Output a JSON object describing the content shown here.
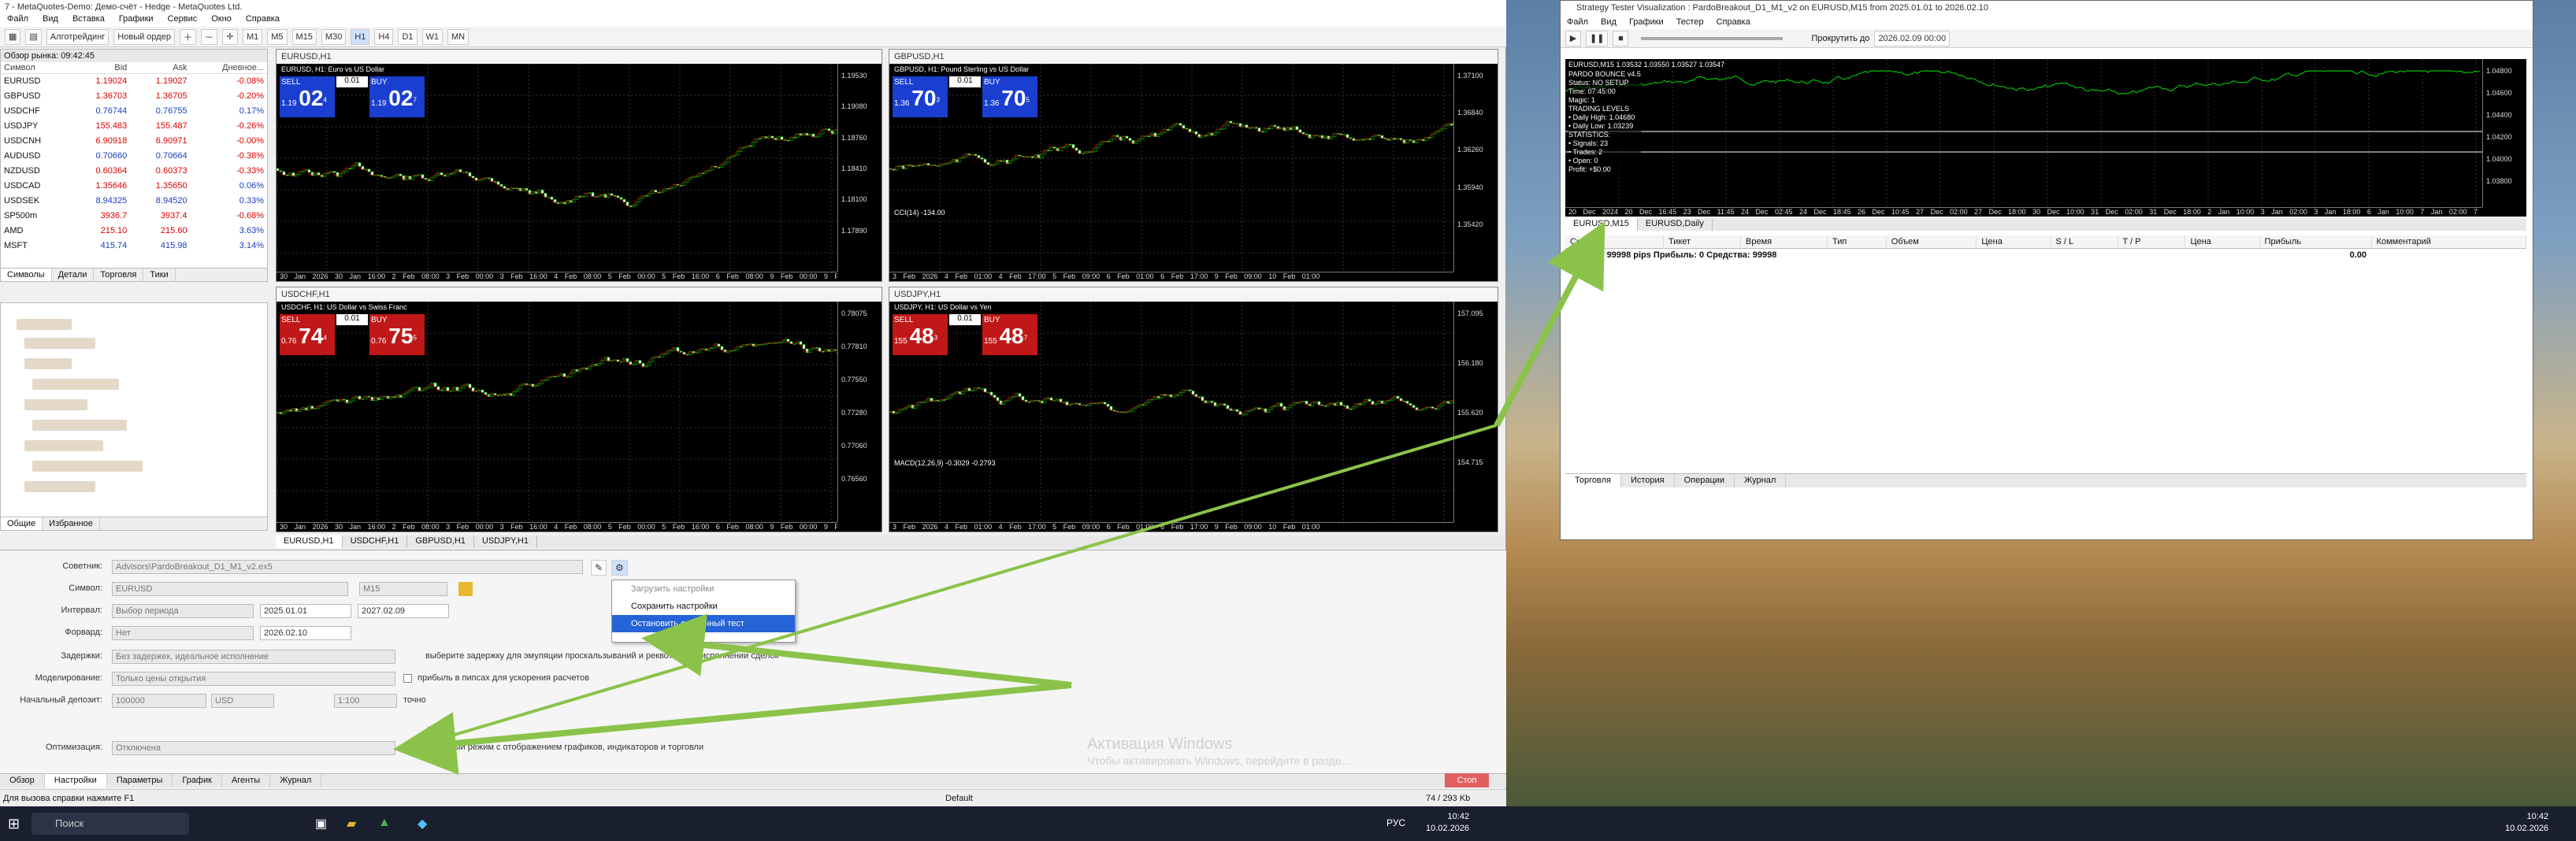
{
  "main": {
    "title": "7 - MetaQuotes-Demo: Демо-счёт - Hedge - MetaQuotes Ltd.",
    "menu": [
      "Файл",
      "Вид",
      "Вставка",
      "Графики",
      "Сервис",
      "Окно",
      "Справка"
    ],
    "toolbar": {
      "algo": "Алготрейдинг",
      "new_order": "Новый ордер",
      "timeframes": [
        "M1",
        "M5",
        "M15",
        "M30",
        "H1",
        "H4",
        "D1",
        "W1",
        "MN"
      ]
    },
    "market_watch": {
      "header": "Обзор рынка: 09:42:45",
      "columns": [
        "Символ",
        "Bid",
        "Ask",
        "Дневное..."
      ],
      "rows": [
        [
          "EURUSD",
          "1.19024",
          "1.19027",
          "-0.08%"
        ],
        [
          "GBPUSD",
          "1.36703",
          "1.36705",
          "-0.20%"
        ],
        [
          "USDCHF",
          "0.76744",
          "0.76755",
          "0.17%"
        ],
        [
          "USDJPY",
          "155.483",
          "155.487",
          "-0.26%"
        ],
        [
          "USDCNH",
          "6.90918",
          "6.90971",
          "-0.00%"
        ],
        [
          "AUDUSD",
          "0.70660",
          "0.70664",
          "-0.38%"
        ],
        [
          "NZDUSD",
          "0.60364",
          "0.60373",
          "-0.33%"
        ],
        [
          "USDCAD",
          "1.35646",
          "1.35650",
          "0.06%"
        ],
        [
          "USDSEK",
          "8.94325",
          "8.94520",
          "0.33%"
        ],
        [
          "SP500m",
          "3936.7",
          "3937.4",
          "-0.68%"
        ],
        [
          "AMD",
          "215.10",
          "215.60",
          "3.63%"
        ],
        [
          "MSFT",
          "415.74",
          "415.98",
          "3.14%"
        ]
      ],
      "tabs": [
        "Символы",
        "Детали",
        "Торговля",
        "Тики"
      ]
    },
    "navigator_tabs": [
      "Общие",
      "Избранное"
    ],
    "charts": [
      {
        "title": "EURUSD,H1",
        "subtitle": "EURUSD, H1: Euro vs US Dollar",
        "sell": "1.19",
        "sell_big": "02",
        "sell_sup": "4",
        "buy": "1.19",
        "buy_big": "02",
        "buy_sup": "7",
        "lot": "0.01",
        "sell_label": "SELL",
        "buy_label": "BUY",
        "scale": [
          "1.19530",
          "1.19080",
          "1.18760",
          "1.18410",
          "1.18100",
          "1.17890"
        ],
        "times": "30 Jan 2026  30 Jan 16:00  2 Feb 08:00  3 Feb 00:00  3 Feb 16:00  4 Feb 08:00  5 Feb 00:00  5 Feb 16:00  6 Feb 08:00  9 Feb 00:00  9 Feb 16:00  10 Feb 08:00",
        "color": "blue"
      },
      {
        "title": "GBPUSD,H1",
        "subtitle": "GBPUSD, H1: Pound Sterling vs US Dollar",
        "sell": "1.36",
        "sell_big": "70",
        "sell_sup": "3",
        "buy": "1.36",
        "buy_big": "70",
        "buy_sup": "5",
        "lot": "0.01",
        "sell_label": "SELL",
        "buy_label": "BUY",
        "scale": [
          "1.37100",
          "1.36840",
          "1.36260",
          "1.35940",
          "1.35420"
        ],
        "times": "3 Feb 2026  4 Feb 01:00  4 Feb 17:00  5 Feb 09:00  6 Feb 01:00  6 Feb 17:00  9 Feb 09:00  10 Feb 01:00",
        "color": "blue",
        "indicator": "CCI(14) -134.00"
      },
      {
        "title": "USDCHF,H1",
        "subtitle": "USDCHF, H1: US Dollar vs Swiss Franc",
        "sell": "0.76",
        "sell_big": "74",
        "sell_sup": "4",
        "buy": "0.76",
        "buy_big": "75",
        "buy_sup": "5",
        "lot": "0.01",
        "sell_label": "SELL",
        "buy_label": "BUY",
        "scale": [
          "0.78075",
          "0.77810",
          "0.77550",
          "0.77280",
          "0.77060",
          "0.76560"
        ],
        "times": "30 Jan 2026  30 Jan 16:00  2 Feb 08:00  3 Feb 00:00  3 Feb 16:00  4 Feb 08:00  5 Feb 00:00  5 Feb 16:00  6 Feb 08:00  9 Feb 00:00  9 Feb 16:00  10 Feb 08:00",
        "color": "red"
      },
      {
        "title": "USDJPY,H1",
        "subtitle": "USDJPY, H1: US Dollar vs Yen",
        "sell": "155",
        "sell_big": "48",
        "sell_sup": "3",
        "buy": "155",
        "buy_big": "48",
        "buy_sup": "7",
        "lot": "0.01",
        "sell_label": "SELL",
        "buy_label": "BUY",
        "scale": [
          "157.095",
          "156.180",
          "155.620",
          "154.715"
        ],
        "times": "3 Feb 2026  4 Feb 01:00  4 Feb 17:00  5 Feb 09:00  6 Feb 01:00  6 Feb 17:00  9 Feb 09:00  10 Feb 01:00",
        "color": "red",
        "indicator": "MACD(12,26,9) -0.3029 -0.2793"
      }
    ],
    "chart_tabs": [
      "EURUSD,H1",
      "USDCHF,H1",
      "GBPUSD,H1",
      "USDJPY,H1"
    ],
    "tester": {
      "expert_label": "Советник:",
      "expert": "Advisors\\PardoBreakout_D1_M1_v2.ex5",
      "symbol_label": "Символ:",
      "symbol": "EURUSD",
      "period": "M15",
      "interval_label": "Интервал:",
      "interval": "Выбор периода",
      "date_from": "2025.01.01",
      "date_to": "2027.02.09",
      "forward_label": "Форвард:",
      "forward": "Нет",
      "forward_date": "2026.02.10",
      "delays_label": "Задержки:",
      "delays": "Без задержек, идеальное исполнение",
      "delays_hint": "выберите задержку для эмуляции проскальзываний и реквотов при исполнении сделок",
      "model_label": "Моделирование:",
      "model": "Только цены открытия",
      "model_hint": "прибыль в пипсах для ускорения расчетов",
      "deposit_label": "Начальный депозит:",
      "deposit": "100000",
      "currency": "USD",
      "leverage": "1:100",
      "leverage_hint": "точно",
      "opt_label": "Оптимизация:",
      "opt": "Отключена",
      "visual_hint": "визуальный режим с отображением графиков, индикаторов и торговли"
    },
    "context_menu": [
      "Загрузить настройки",
      "Сохранить настройки",
      "Остановить одиночный тест"
    ],
    "bottom_tabs": [
      "Обзор",
      "Настройки",
      "Параметры",
      "График",
      "Агенты",
      "Журнал"
    ],
    "stop": "Стоп",
    "status": "Для вызова справки нажмите F1",
    "status_mid": "Default",
    "status_right": "74 / 293 Kb",
    "activation_title": "Активация Windows",
    "activation_text": "Чтобы активировать Windows, перейдите в разде..."
  },
  "visual": {
    "title": "Strategy Tester Visualization : PardoBreakout_D1_M1_v2 on EURUSD,M15 from 2025.01.01 to 2026.02.10",
    "menu": [
      "Файл",
      "Вид",
      "Графики",
      "Тестер",
      "Справка"
    ],
    "scroll_to": "Прокрутить до",
    "scroll_date": "2026.02.09 00:00",
    "chart_title": "EURUSD,M15  1.03532 1.03550 1.03527 1.03547",
    "overlay": [
      "PARDO BOUNCE v4.5",
      "Status: NO SETUP",
      "Time: 07:45:00",
      "Magic: 1",
      "TRADING LEVELS",
      "• Daily High: 1.04680",
      "• Daily Low: 1.03239",
      "STATISTICS:",
      "• Signals: 23",
      "• Trades: 2",
      "• Open: 0",
      "Profit: +$0.00"
    ],
    "scale": [
      "1.04800",
      "1.04600",
      "1.04400",
      "1.04200",
      "1.04000",
      "1.03800"
    ],
    "times": "20 Dec 2024  20 Dec 16:45  23 Dec 11:45  24 Dec 02:45  24 Dec 18:45  26 Dec 10:45  27 Dec 02:00  27 Dec 18:00  30 Dec 10:00  31 Dec 02:00  31 Dec 18:00  2 Jan 10:00  3 Jan 02:00  3 Jan 18:00  6 Jan 10:00  7 Jan 02:00  7 Jan 22:00",
    "tabs": [
      "EURUSD,M15",
      "EURUSD,Daily"
    ],
    "table_cols": [
      "Символ",
      "Тикет",
      "Время",
      "Тип",
      "Объем",
      "Цена",
      "S / L",
      "T / P",
      "Цена",
      "Прибыль",
      "Комментарий"
    ],
    "balance": "Баланс: 99998 pips  Прибыль: 0  Средства: 99998",
    "balance_profit": "0.00",
    "bottom_tabs": [
      "Торговля",
      "История",
      "Операции",
      "Журнал"
    ]
  },
  "taskbar": {
    "search": "Поиск",
    "lang": "РУС",
    "time": "10:42",
    "date": "10.02.2026"
  },
  "colors": {
    "sell": "#c01818",
    "buy_blue": "#1a3fd0",
    "candle": "#00c000",
    "arrow": "#8bc34a"
  }
}
